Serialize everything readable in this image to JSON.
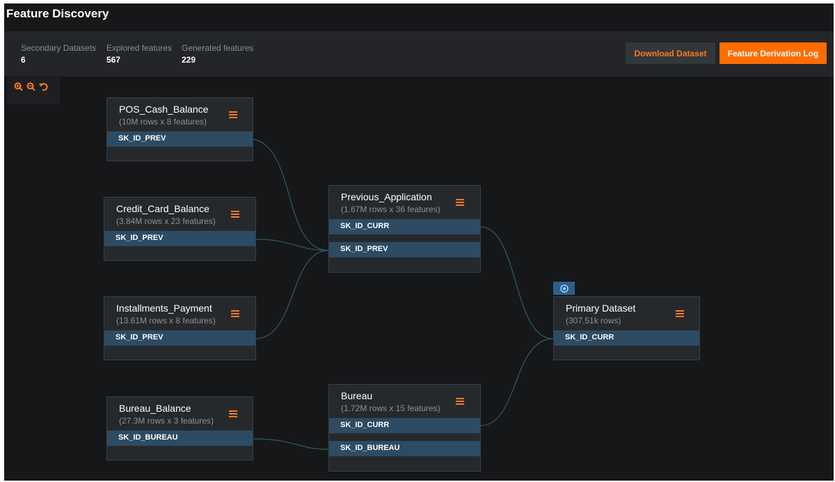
{
  "app": {
    "title": "Feature Discovery"
  },
  "stats": [
    {
      "label": "Secondary Datasets",
      "value": "6"
    },
    {
      "label": "Explored features",
      "value": "567"
    },
    {
      "label": "Generated features",
      "value": "229"
    }
  ],
  "toolbar": {
    "download_label": "Download Dataset",
    "derivation_log_label": "Feature Derivation Log"
  },
  "zoom_controls": [
    "zoom-in-icon",
    "zoom-out-icon",
    "reset-view-icon"
  ],
  "colors": {
    "accent": "#ff6d00",
    "background": "#161719",
    "node": "#26292c",
    "key_row": "#2d4b63",
    "edge": "#2f5d63"
  },
  "nodes": {
    "pos_cash": {
      "name": "POS_Cash_Balance",
      "sub": "(10M rows x 8 features)",
      "keys": [
        "SK_ID_PREV"
      ]
    },
    "credit_card": {
      "name": "Credit_Card_Balance",
      "sub": "(3.84M rows x 23 features)",
      "keys": [
        "SK_ID_PREV"
      ]
    },
    "installments": {
      "name": "Installments_Payment",
      "sub": "(13.61M rows x 8 features)",
      "keys": [
        "SK_ID_PREV"
      ]
    },
    "bureau_balance": {
      "name": "Bureau_Balance",
      "sub": "(27.3M rows x 3 features)",
      "keys": [
        "SK_ID_BUREAU"
      ]
    },
    "previous_app": {
      "name": "Previous_Application",
      "sub": "(1.67M rows x 36 features)",
      "keys": [
        "SK_ID_CURR",
        "SK_ID_PREV"
      ]
    },
    "bureau": {
      "name": "Bureau",
      "sub": "(1.72M rows x 15 features)",
      "keys": [
        "SK_ID_CURR",
        "SK_ID_BUREAU"
      ]
    },
    "primary": {
      "name": "Primary Dataset",
      "sub": "(307.51k rows)",
      "keys": [
        "SK_ID_CURR"
      ],
      "badge_icon": "target-icon"
    }
  }
}
